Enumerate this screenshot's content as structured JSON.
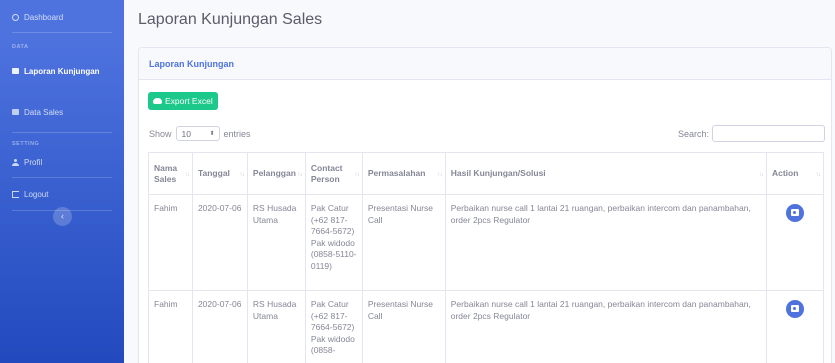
{
  "sidebar": {
    "dashboard": "Dashboard",
    "heading_data": "DATA",
    "laporan": "Laporan Kunjungan",
    "data_sales": "Data Sales",
    "heading_setting": "SETTING",
    "profil": "Profil",
    "logout": "Logout",
    "toggle": "‹"
  },
  "page": {
    "title": "Laporan Kunjungan Sales",
    "card_title": "Laporan Kunjungan",
    "export_label": "Export Excel",
    "show_label": "Show",
    "entries_value": "10",
    "entries_label": "entries",
    "search_label": "Search:"
  },
  "table": {
    "headers": [
      "Nama Sales",
      "Tanggal",
      "Pelanggan",
      "Contact Person",
      "Permasalahan",
      "Hasil Kunjungan/Solusi",
      "Action"
    ],
    "rows": [
      {
        "nama": "Fahim",
        "tanggal": "2020-07-06",
        "pelanggan": "RS Husada Utama",
        "contact": "Pak Catur (+62 817-7664-5672) Pak widodo (0858-5110-0119)",
        "permasalahan": "Presentasi Nurse Call",
        "hasil": "Perbaikan nurse call 1 lantai 21 ruangan, perbaikan intercom dan panambahan, order 2pcs Regulator"
      },
      {
        "nama": "Fahim",
        "tanggal": "2020-07-06",
        "pelanggan": "RS Husada Utama",
        "contact": "Pak Catur (+62 817-7664-5672) Pak widodo (0858-",
        "permasalahan": "Presentasi Nurse Call",
        "hasil": "Perbaikan nurse call 1 lantai 21 ruangan, perbaikan intercom dan panambahan, order 2pcs Regulator"
      }
    ]
  },
  "colors": {
    "primary": "#4e73df",
    "success": "#1cc88a"
  }
}
